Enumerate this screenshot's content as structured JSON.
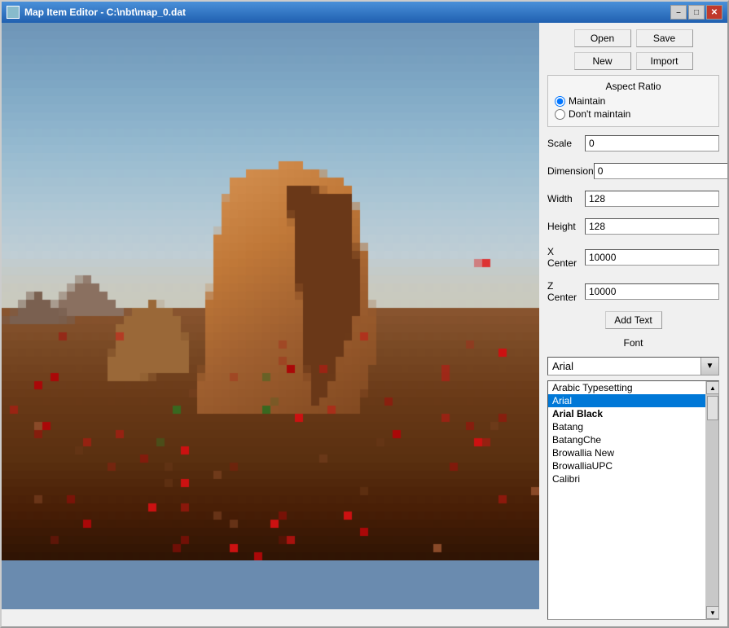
{
  "window": {
    "title": "Map Item Editor - C:\\nbt\\map_0.dat",
    "icon": "map-icon"
  },
  "title_controls": {
    "minimize": "–",
    "maximize": "□",
    "close": "✕"
  },
  "toolbar": {
    "open_label": "Open",
    "save_label": "Save",
    "new_label": "New",
    "import_label": "Import"
  },
  "aspect_ratio": {
    "group_label": "Aspect Ratio",
    "maintain_label": "Maintain",
    "dont_maintain_label": "Don't maintain",
    "maintain_checked": true
  },
  "fields": {
    "scale": {
      "label": "Scale",
      "value": "0"
    },
    "dimension": {
      "label": "Dimension",
      "value": "0"
    },
    "width": {
      "label": "Width",
      "value": "128"
    },
    "height": {
      "label": "Height",
      "value": "128"
    },
    "x_center": {
      "label": "X Center",
      "value": "10000"
    },
    "z_center": {
      "label": "Z Center",
      "value": "10000"
    }
  },
  "add_text_btn": "Add Text",
  "font": {
    "label": "Font",
    "current": "Arial",
    "items": [
      {
        "name": "Arabic Typesetting",
        "style": "normal"
      },
      {
        "name": "Arial",
        "style": "normal",
        "selected": true
      },
      {
        "name": "Arial Black",
        "style": "bold"
      },
      {
        "name": "Batang",
        "style": "normal"
      },
      {
        "name": "BatangChe",
        "style": "normal"
      },
      {
        "name": "Browallia New",
        "style": "normal"
      },
      {
        "name": "BrowalliaUPC",
        "style": "normal"
      },
      {
        "name": "Calibri",
        "style": "normal"
      }
    ]
  }
}
